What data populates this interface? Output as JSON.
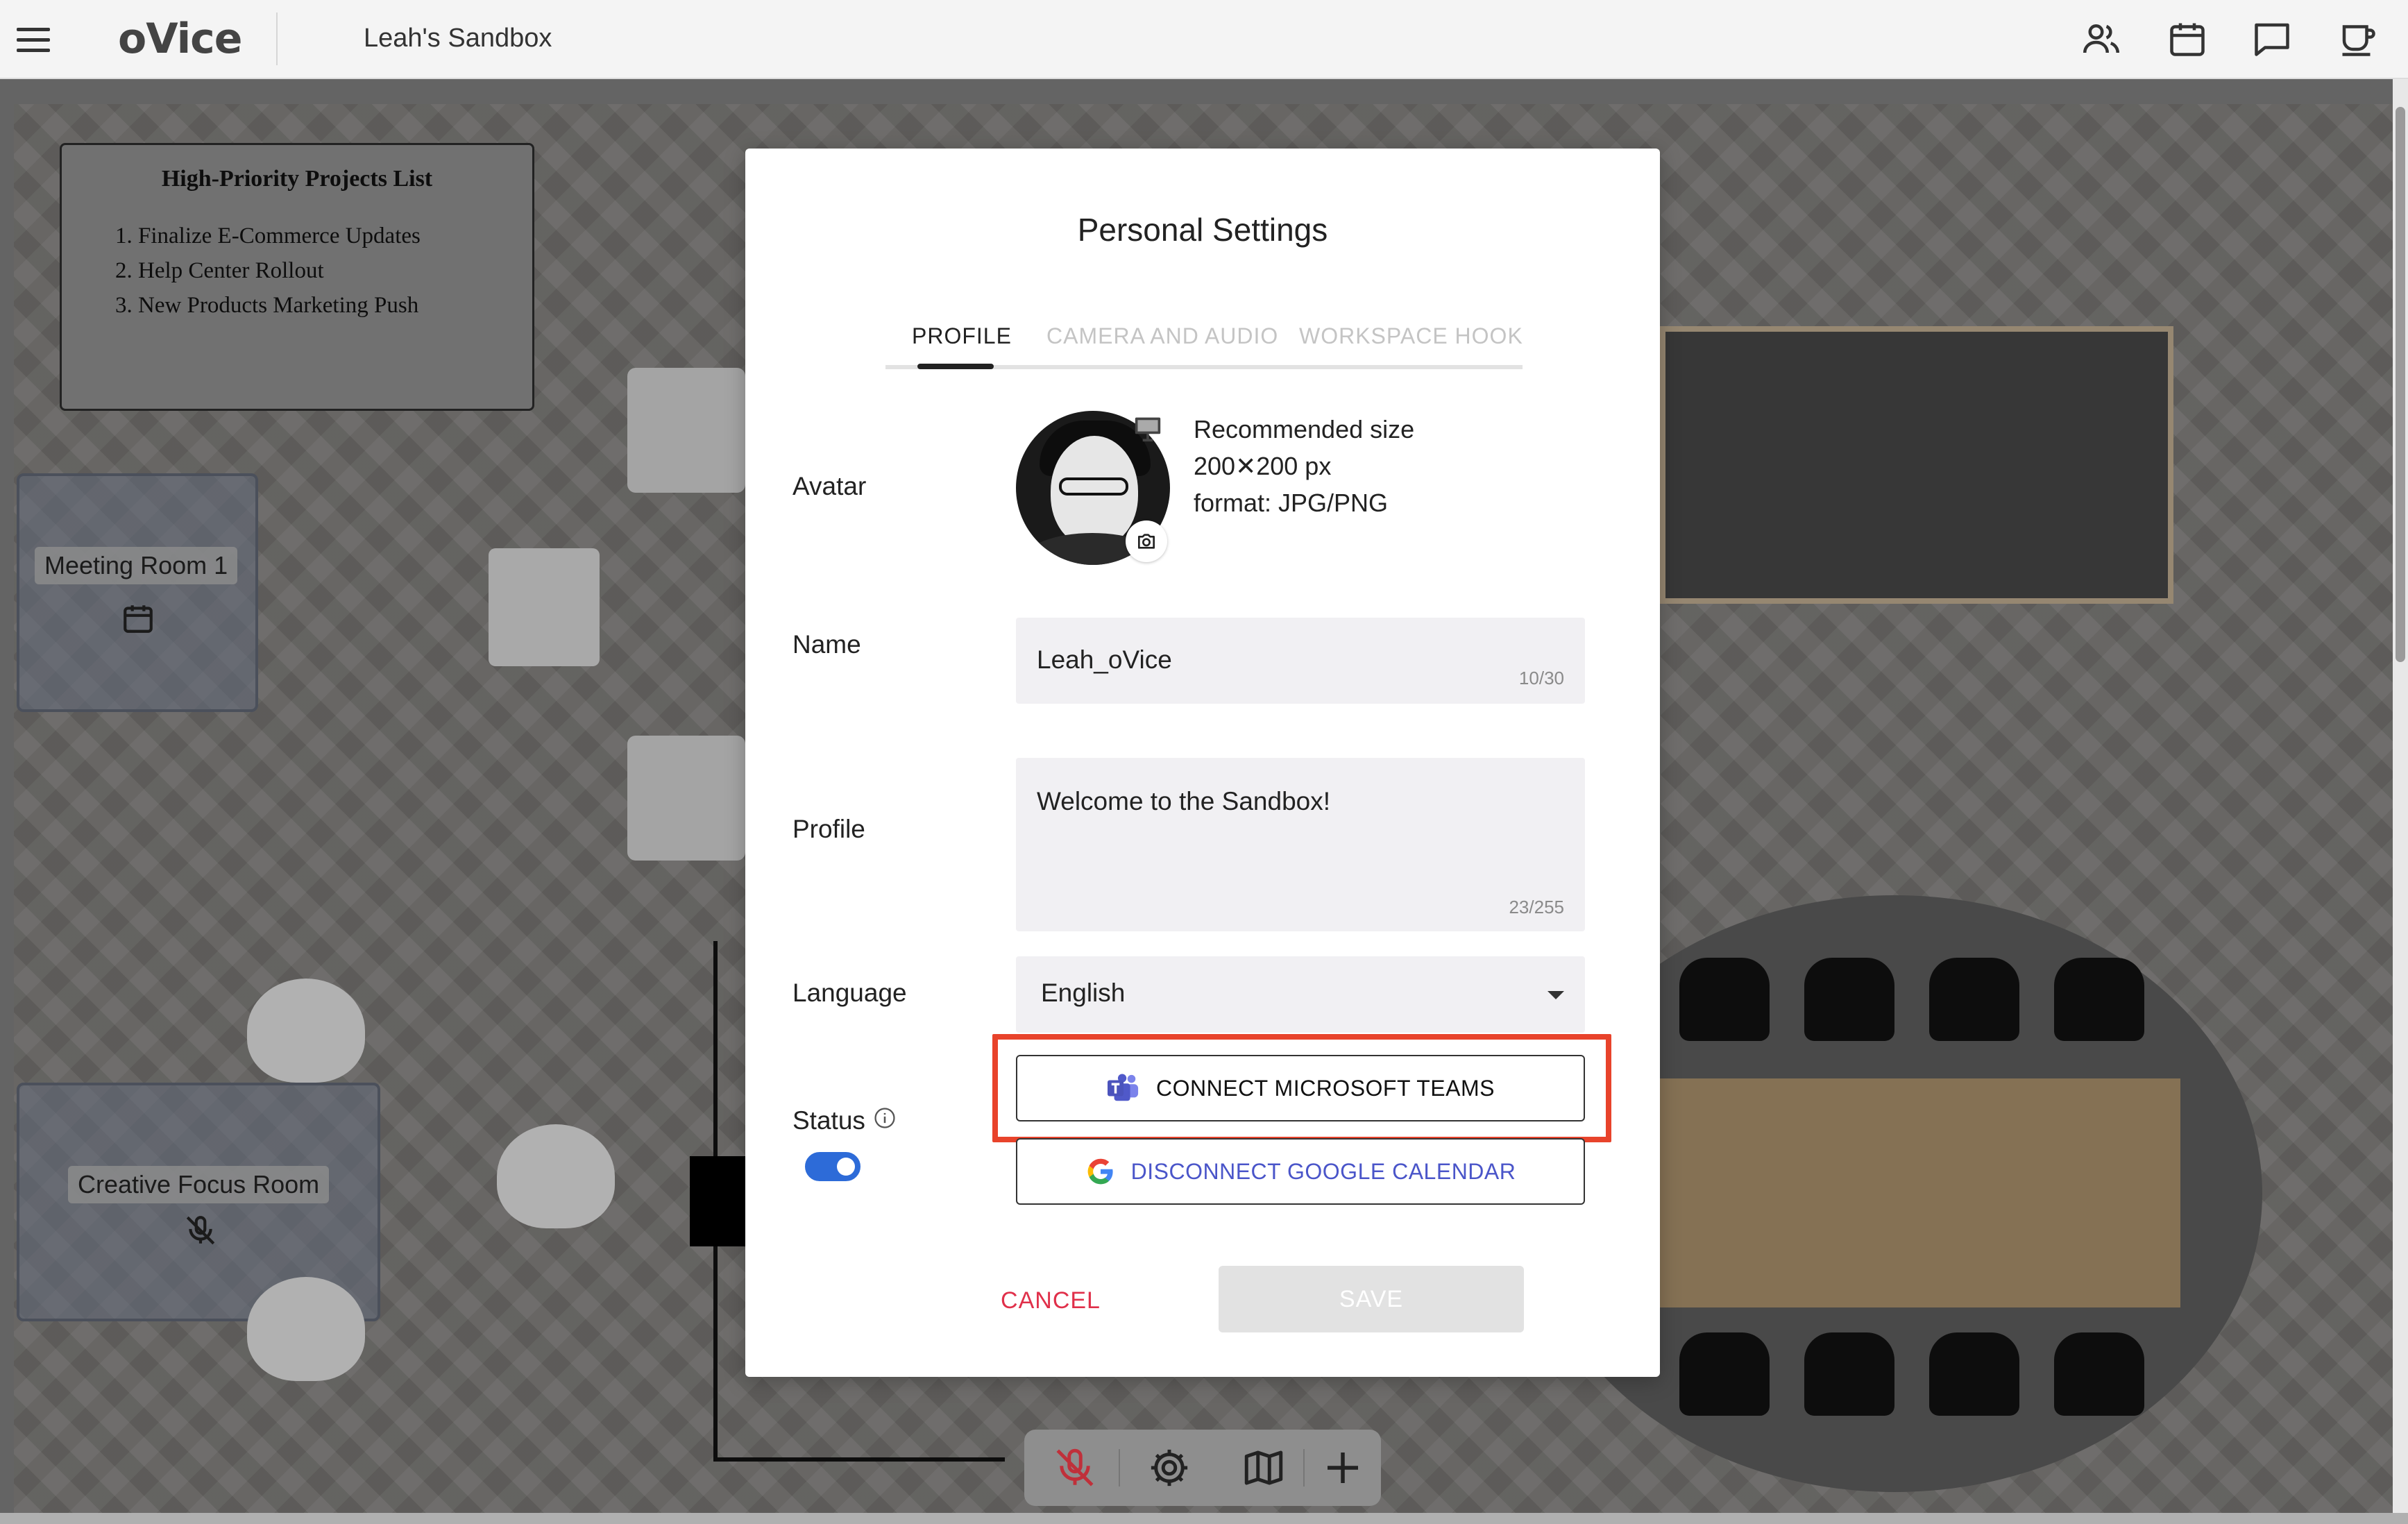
{
  "topbar": {
    "logo": "oVice",
    "workspace_name": "Leah's Sandbox",
    "icons": [
      "members-icon",
      "calendar-icon",
      "chat-icon",
      "coffee-cup-icon"
    ]
  },
  "canvas": {
    "note": {
      "title": "High-Priority Projects List",
      "items": [
        "Finalize E-Commerce Updates",
        "Help Center Rollout",
        "New Products Marketing Push"
      ]
    },
    "rooms": [
      {
        "name": "Meeting Room 1",
        "icon": "calendar-icon"
      },
      {
        "name": "Creative Focus Room",
        "icon": "mic-off-icon"
      }
    ]
  },
  "bottom_toolbar": {
    "icons": [
      "mic-off-icon",
      "gear-icon",
      "map-icon",
      "plus-icon"
    ]
  },
  "modal": {
    "title": "Personal Settings",
    "tabs": [
      {
        "label": "PROFILE",
        "active": true
      },
      {
        "label": "CAMERA AND AUDIO",
        "active": false
      },
      {
        "label": "WORKSPACE HOOK",
        "active": false
      }
    ],
    "avatar": {
      "label": "Avatar",
      "info_line1": "Recommended size",
      "info_line2": "200✕200 px",
      "info_line3": "format: JPG/PNG"
    },
    "name": {
      "label": "Name",
      "value": "Leah_oVice",
      "counter": "10/30"
    },
    "profile": {
      "label": "Profile",
      "value": "Welcome to the Sandbox!",
      "counter": "23/255"
    },
    "language": {
      "label": "Language",
      "value": "English"
    },
    "status": {
      "label": "Status",
      "enabled": true
    },
    "connect_teams_label": "CONNECT MICROSOFT TEAMS",
    "disconnect_google_label": "DISCONNECT GOOGLE CALENDAR",
    "cancel_label": "CANCEL",
    "save_label": "SAVE"
  },
  "colors": {
    "accent_blue": "#2d6bd8",
    "cancel_red": "#e0304a",
    "highlight_red": "#e8432b",
    "google_link": "#4a55c9"
  }
}
